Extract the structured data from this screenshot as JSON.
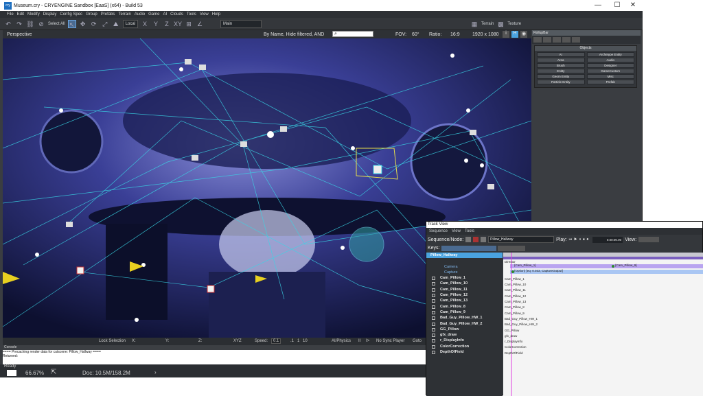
{
  "window": {
    "title": "Museum.cry - CRYENGINE Sandbox [EaaS] (x64) - Build 53",
    "app_icon": "cry",
    "minimize": "—",
    "maximize": "☐",
    "close": "✕"
  },
  "menu": [
    "File",
    "Edit",
    "Modify",
    "Display",
    "Config Spec",
    "Group",
    "Prefabs",
    "Terrain",
    "Audio",
    "Game",
    "AI",
    "Clouds",
    "Tools",
    "View",
    "Help"
  ],
  "toolbar": {
    "select_all": "Select All",
    "coord_system": "Local",
    "axes": [
      "X",
      "Y",
      "Z",
      "XY"
    ],
    "layer": "Main",
    "terrain": "Terrain",
    "texture": "Texture"
  },
  "viewport": {
    "label": "Perspective",
    "filter_text": "By Name, Hide filtered, AND",
    "fov_label": "FOV:",
    "fov_value": "60°",
    "ratio_label": "Ratio:",
    "ratio_value": "16:9",
    "resolution": "1920 x 1080",
    "btn_i": "i",
    "btn_h": "H"
  },
  "status": {
    "lock_selection": "Lock Selection",
    "x": "X:",
    "y": "Y:",
    "z": "Z:",
    "xyz": "XYZ",
    "speed_label": "Speed:",
    "speed_value": "0.1",
    "speed_opts": [
      ".1",
      "1",
      "10"
    ],
    "ai_physics": "AI/Physics",
    "pause": "II",
    "next": "I>",
    "no_sync": "No Sync Player",
    "goto": "Goto"
  },
  "console": {
    "title": "Console",
    "line1": "==== Precaching render data for cutscene: Pillow_Hallway ====",
    "line2": "Returned:"
  },
  "footer": {
    "ready": "Ready",
    "zoom": "66.67%",
    "doc": "Doc: 10.5M/158.2M"
  },
  "rollup": {
    "title": "RollupBar",
    "objects_header": "Objects",
    "buttons": [
      "AI",
      "Archetype Entity",
      "Area",
      "Audio",
      "Brush",
      "Designer",
      "Entity",
      "GameCustom",
      "Geom Entity",
      "Misc",
      "Particle Entity",
      "Prefab"
    ]
  },
  "trackview": {
    "title": "Track View",
    "menu": [
      "Sequence",
      "View",
      "Tools"
    ],
    "sequence_label": "Sequence/Node:",
    "sequence_value": "Pillow_Hallway",
    "play_label": "Play:",
    "time": "0.00:00.00",
    "view_label": "View:",
    "keys_label": "Keys:",
    "tree": [
      {
        "label": "Pillow_Hallway",
        "kind": "sel"
      },
      {
        "label": "",
        "kind": "blank"
      },
      {
        "label": "Camera",
        "kind": "sub"
      },
      {
        "label": "Capture",
        "kind": "sub"
      },
      {
        "label": "Cam_Pillow_1",
        "kind": "item"
      },
      {
        "label": "Cam_Pillow_10",
        "kind": "item"
      },
      {
        "label": "Cam_Pillow_11",
        "kind": "item"
      },
      {
        "label": "Cam_Pillow_12",
        "kind": "item"
      },
      {
        "label": "Cam_Pillow_13",
        "kind": "item"
      },
      {
        "label": "Cam_Pillow_8",
        "kind": "item"
      },
      {
        "label": "Cam_Pillow_9",
        "kind": "item"
      },
      {
        "label": "Bad_Guy_Pillow_HW_1",
        "kind": "item"
      },
      {
        "label": "Bad_Guy_Pillow_HW_2",
        "kind": "item"
      },
      {
        "label": "GG_Pillow",
        "kind": "item"
      },
      {
        "label": "gfx_draw",
        "kind": "item"
      },
      {
        "label": "r_DisplayInfo",
        "kind": "item"
      },
      {
        "label": "ColorCorrection",
        "kind": "item"
      },
      {
        "label": "DepthOfField",
        "kind": "item"
      }
    ],
    "timeline_rows": [
      "Director",
      "",
      "",
      "Cam_Pillow_1",
      "Cam_Pillow_10",
      "Cam_Pillow_11",
      "Cam_Pillow_12",
      "Cam_Pillow_13",
      "Cam_Pillow_8",
      "Cam_Pillow_9",
      "Bad_Guy_Pillow_HW_1",
      "Bad_Guy_Pillow_HW_2",
      "GG_Pillow",
      "gfx_draw",
      "r_DisplayInfo",
      "ColorCorrection",
      "DepthOfField"
    ],
    "key_camera_1": "{Cam_Pillow_1}",
    "key_camera_2": "{Cam_Pillow_9}",
    "key_capture": "{Option} [eq: 0.033, CaptureOutput]"
  },
  "colors": {
    "accent": "#4aa3e0",
    "timeline_cursor": "#e040e0",
    "selection_line": "#7ad0ff"
  }
}
